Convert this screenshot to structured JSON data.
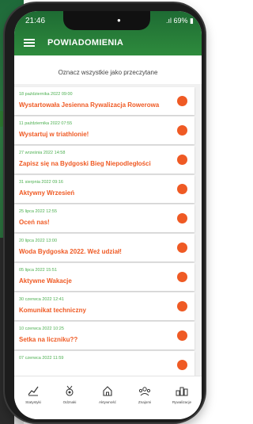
{
  "status": {
    "time": "21:46",
    "battery": "69%"
  },
  "header": {
    "title": "POWIADOMIENIA"
  },
  "mark_all": "Oznacz wszystkie jako przeczytane",
  "notifications": [
    {
      "date": "18 października 2022 09:00",
      "title": "Wystartowała Jesienna Rywalizacja Rowerowa"
    },
    {
      "date": "11 października 2022 07:55",
      "title": "Wystartuj w triathlonie!"
    },
    {
      "date": "27 września 2022 14:58",
      "title": "Zapisz się na Bydgoski Bieg Niepodległości"
    },
    {
      "date": "31 sierpnia 2022 09:16",
      "title": "Aktywny Wrzesień"
    },
    {
      "date": "25 lipca 2022 12:55",
      "title": "Oceń nas!"
    },
    {
      "date": "20 lipca 2022 13:00",
      "title": "Woda Bydgoska 2022. Weź udział!"
    },
    {
      "date": "05 lipca 2022 15:51",
      "title": "Aktywne Wakacje"
    },
    {
      "date": "30 czerwca 2022 12:41",
      "title": "Komunikat techniczny"
    },
    {
      "date": "10 czerwca 2022 10:25",
      "title": "Setka na liczniku??"
    },
    {
      "date": "07 czerwca 2022 11:59",
      "title": ""
    }
  ],
  "nav": [
    {
      "label": "Statystyki",
      "icon": "chart-icon"
    },
    {
      "label": "Odznaki",
      "icon": "medal-icon"
    },
    {
      "label": "Aktywność",
      "icon": "home-icon"
    },
    {
      "label": "Znajomi",
      "icon": "friends-icon"
    },
    {
      "label": "Rywalizacje",
      "icon": "ranking-icon"
    }
  ],
  "colors": {
    "green": "#2e8b3d",
    "accent": "#ef5a24",
    "date_green": "#4caf50"
  }
}
